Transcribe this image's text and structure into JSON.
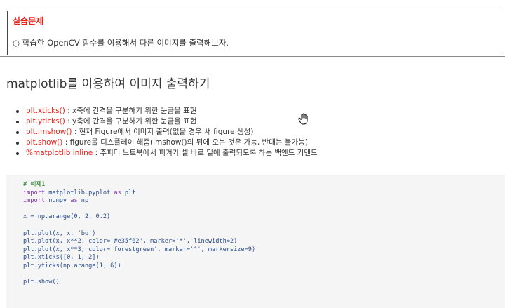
{
  "practice": {
    "title": "실습문제",
    "body": "○ 학습한 OpenCV 함수를 이용해서 다른 이미지를 출력해보자."
  },
  "heading": "matplotlib를 이용하여 이미지 출력하기",
  "bullets": [
    {
      "key": "plt.xticks()",
      "text": " : x축에 간격을 구분하기 위한 눈금을 표현"
    },
    {
      "key": "plt.yticks()",
      "text": " : y축에 간격을 구분하기 위한 눈금을 표현"
    },
    {
      "key": "plt.imshow()",
      "text": " : 현재 Figure에서 이미지 출력(없을 경우 새 figure 생성)"
    },
    {
      "key": "plt.show()",
      "text": " : figure를 디스플레이 해줌(imshow()의 뒤에 오는 것은 가능, 반대는 불가능)"
    },
    {
      "key": "%matplotlib inline",
      "text": " : 주피터 노트북에서 피겨가 셀 바로 밑에 출력되도록 하는 백엔드 커맨드"
    }
  ],
  "code": {
    "comment": "# 예제1",
    "import1_kw": "import",
    "import1_rest": " matplotlib.pyplot ",
    "import1_as": "as",
    "import1_alias": " plt",
    "import2_kw": "import",
    "import2_rest": " numpy ",
    "import2_as": "as",
    "import2_alias": " np",
    "line_x": "x = np.arange(0, 2, 0.2)",
    "plot1": "plt.plot(x, x, 'bo')",
    "plot2": "plt.plot(x, x**2, color='#e35f62', marker='*', linewidth=2)",
    "plot3": "plt.plot(x, x**3, color='forestgreen', marker='^', markersize=9)",
    "xticks": "plt.xticks([0, 1, 2])",
    "yticks": "plt.yticks(np.arange(1, 6))",
    "show": "plt.show()"
  },
  "icons": {
    "cursor": "hand-pointer-icon"
  }
}
